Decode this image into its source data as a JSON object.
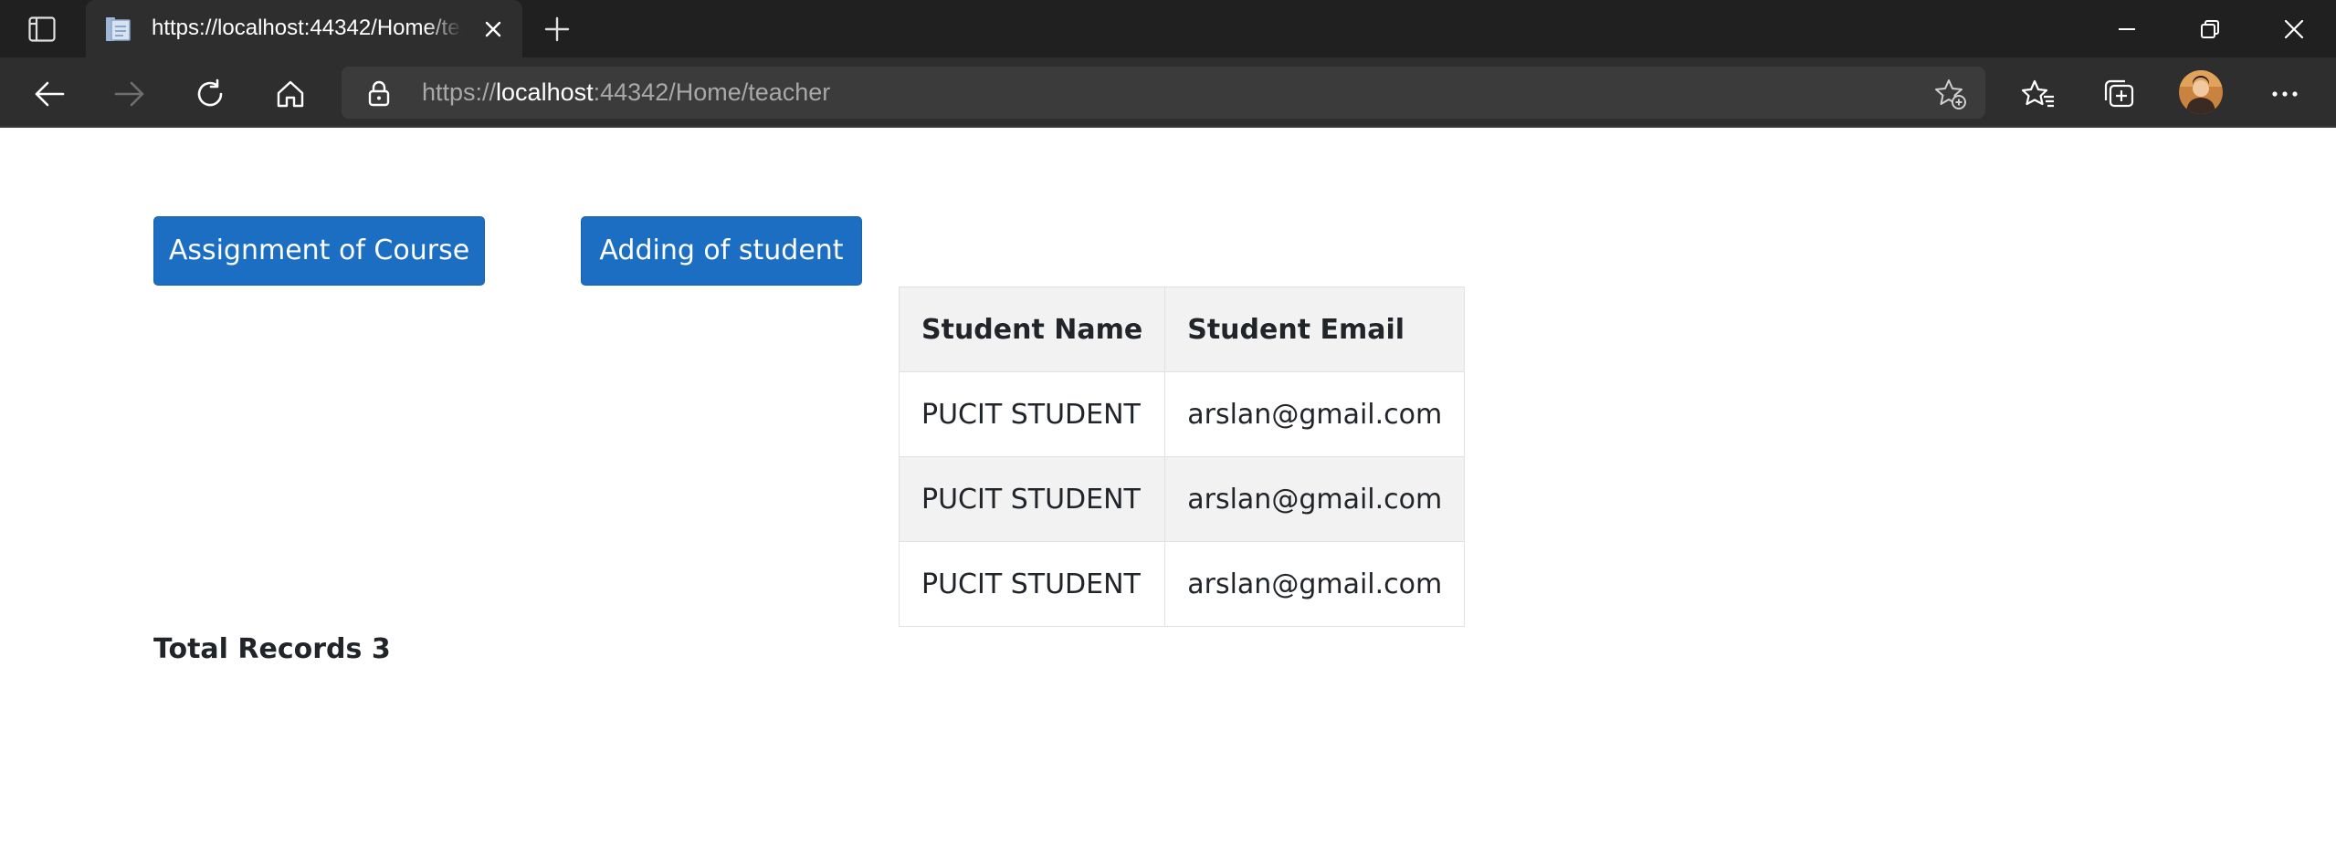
{
  "browser": {
    "tab": {
      "title": "https://localhost:44342/Home/teacher"
    },
    "address": {
      "scheme": "https://",
      "host": "localhost",
      "rest": ":44342/Home/teacher"
    },
    "icons": {
      "tab_actions": "tab-actions-icon",
      "favicon": "page-favicon-icon",
      "close_tab": "close-icon",
      "new_tab": "plus-icon",
      "minimize": "minimize-icon",
      "restore": "restore-icon",
      "close_window": "close-icon",
      "back": "back-arrow-icon",
      "forward": "forward-arrow-icon",
      "refresh": "refresh-icon",
      "home": "home-icon",
      "lock": "lock-icon",
      "add_favorite": "add-favorite-icon",
      "favorites": "favorites-icon",
      "collections": "collections-icon",
      "more": "more-icon"
    },
    "colors": {
      "titlebar": "#202020",
      "toolbar": "#2e2e2e",
      "addressbar": "#3b3b3b"
    }
  },
  "page": {
    "buttons": {
      "assignment": "Assignment of Course",
      "adding": "Adding of student"
    },
    "table": {
      "headers": {
        "name": "Student Name",
        "email": "Student Email"
      },
      "rows": [
        {
          "name": "PUCIT STUDENT",
          "email": "arslan@gmail.com"
        },
        {
          "name": "PUCIT STUDENT",
          "email": "arslan@gmail.com"
        },
        {
          "name": "PUCIT STUDENT",
          "email": "arslan@gmail.com"
        }
      ]
    },
    "total_records": "Total Records 3",
    "colors": {
      "button_bg": "#1b6ec2",
      "stripe": "#f2f2f2",
      "text": "#212529"
    }
  }
}
